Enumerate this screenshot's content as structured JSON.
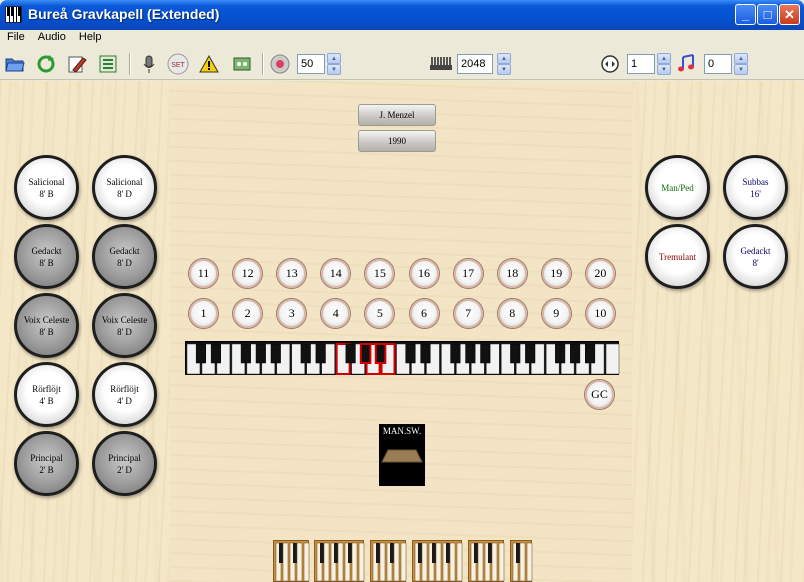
{
  "window": {
    "title": "Bureå Gravkapell (Extended)",
    "minimize_glyph": "_",
    "maximize_glyph": "□",
    "close_glyph": "✕"
  },
  "menu": [
    "File",
    "Audio",
    "Help"
  ],
  "toolbar": {
    "icons": [
      "open-folder-icon",
      "reload-icon",
      "edit-icon",
      "properties-icon",
      "microphone-icon",
      "set-icon",
      "warning-icon",
      "midi-settings-icon",
      "volume-icon",
      "keyboard-icon",
      "transpose-icon",
      "music-note-icon"
    ],
    "set_label": "SET",
    "volume_value": "50",
    "polyphony_value": "2048",
    "transpose_value": "1",
    "reverb_value": "0"
  },
  "console": {
    "plaque_builder": "J. Menzel",
    "plaque_year": "1990",
    "left_stops": [
      {
        "line1": "Salicional",
        "line2": "8' B",
        "state": "on"
      },
      {
        "line1": "Salicional",
        "line2": "8' D",
        "state": "on"
      },
      {
        "line1": "Gedackt",
        "line2": "8' B",
        "state": "off"
      },
      {
        "line1": "Gedackt",
        "line2": "8' D",
        "state": "off"
      },
      {
        "line1": "Voix Celeste",
        "line2": "8' B",
        "state": "off"
      },
      {
        "line1": "Voix Celeste",
        "line2": "8' D",
        "state": "off"
      },
      {
        "line1": "Rörflöjt",
        "line2": "4' B",
        "state": "on"
      },
      {
        "line1": "Rörflöjt",
        "line2": "4' D",
        "state": "on"
      },
      {
        "line1": "Principal",
        "line2": "2' B",
        "state": "off"
      },
      {
        "line1": "Principal",
        "line2": "2' D",
        "state": "off"
      }
    ],
    "right_stops": [
      {
        "line1": "Man/Ped",
        "line2": "",
        "state": "on",
        "color": "#0a6a0a"
      },
      {
        "line1": "Subbas",
        "line2": "16'",
        "state": "on",
        "color": "#000066"
      },
      {
        "line1": "Tremulant",
        "line2": "",
        "state": "on",
        "color": "#8a0000"
      },
      {
        "line1": "Gedackt",
        "line2": "8'",
        "state": "on",
        "color": "#000066"
      }
    ],
    "pistons_top": [
      "11",
      "12",
      "13",
      "14",
      "15",
      "16",
      "17",
      "18",
      "19",
      "20"
    ],
    "pistons_bottom": [
      "1",
      "2",
      "3",
      "4",
      "5",
      "6",
      "7",
      "8",
      "9",
      "10"
    ],
    "gc_label": "GC",
    "swell_label": "MAN.SW.",
    "highlight_color": "#d40000"
  }
}
